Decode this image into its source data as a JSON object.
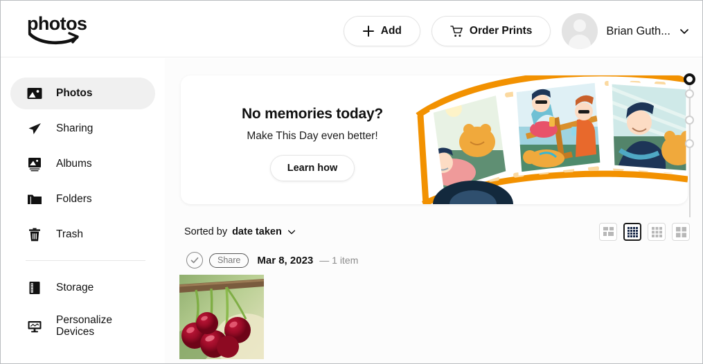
{
  "app": {
    "logo_text": "photos",
    "logo_icon": "amazon-smile-arrow-icon"
  },
  "header": {
    "add_button": {
      "label": "Add",
      "icon": "plus-icon"
    },
    "order_prints_button": {
      "label": "Order Prints",
      "icon": "shopping-cart-icon"
    },
    "user": {
      "name": "Brian Guth...",
      "avatar_icon": "person-avatar-icon",
      "chevron_icon": "chevron-down-icon"
    }
  },
  "sidebar": {
    "items": [
      {
        "label": "Photos",
        "icon": "image-icon",
        "active": true
      },
      {
        "label": "Sharing",
        "icon": "paper-plane-icon",
        "active": false
      },
      {
        "label": "Albums",
        "icon": "albums-icon",
        "active": false
      },
      {
        "label": "Folders",
        "icon": "folder-icon",
        "active": false
      },
      {
        "label": "Trash",
        "icon": "trash-icon",
        "active": false
      }
    ],
    "secondary_items": [
      {
        "label": "Storage",
        "icon": "storage-icon"
      },
      {
        "label": "Personalize Devices",
        "label_line1": "Personalize",
        "label_line2": "Devices",
        "icon": "monitor-icon"
      }
    ]
  },
  "banner": {
    "title": "No memories today?",
    "subtitle": "Make This Day even better!",
    "button_label": "Learn how",
    "illustration": "film-strip-photos-illustration"
  },
  "toolbar": {
    "sort_prefix": "Sorted by",
    "sort_value": "date taken",
    "sort_chevron_icon": "chevron-down-icon",
    "view_modes": [
      {
        "name": "large-grid",
        "icon": "grid-2x2-icon",
        "selected": false
      },
      {
        "name": "dense-grid",
        "icon": "grid-4x4-icon",
        "selected": true
      },
      {
        "name": "medium-grid",
        "icon": "grid-3x3-icon",
        "selected": false
      },
      {
        "name": "comfort-grid",
        "icon": "grid-2x2-large-icon",
        "selected": false
      }
    ]
  },
  "photo_group": {
    "select_icon": "check-circle-icon",
    "share_label": "Share",
    "date": "Mar 8, 2023",
    "count": "— 1 item",
    "photo": {
      "name": "cherries-photo",
      "alt": "cherries hanging from a branch"
    }
  },
  "scrubber": {
    "dots": [
      {
        "active": true
      },
      {
        "active": false
      },
      {
        "active": false
      },
      {
        "active": false
      }
    ]
  },
  "colors": {
    "accent_orange": "#f29100",
    "active_nav_bg": "#f0f0f0",
    "text_primary": "#111111",
    "text_muted": "#8c8c8c"
  }
}
